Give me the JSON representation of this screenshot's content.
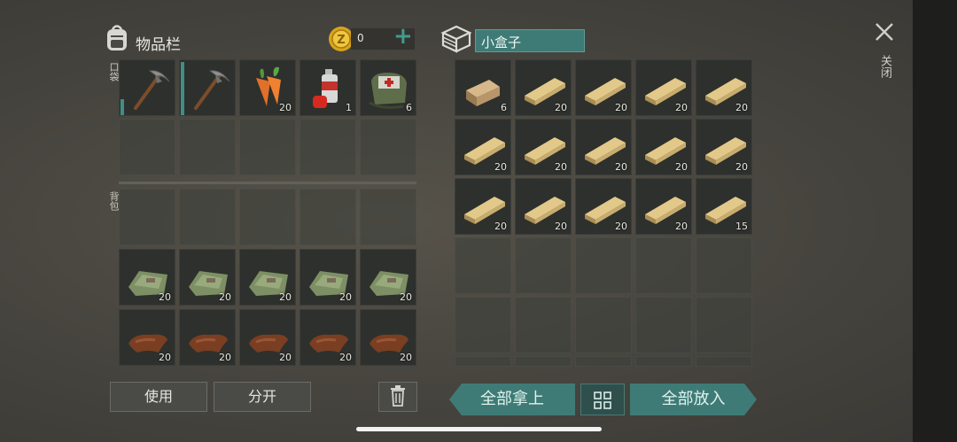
{
  "inventory": {
    "title": "物品栏",
    "coins": "0",
    "plus_label": "+",
    "pocket_label": "口袋",
    "backpack_label": "背包",
    "pocket_row1": [
      {
        "icon": "pickaxe-icon",
        "count": ""
      },
      {
        "icon": "pickaxe-icon",
        "count": ""
      },
      {
        "icon": "carrot-icon",
        "count": "20"
      },
      {
        "icon": "spray-can-icon",
        "count": "1"
      },
      {
        "icon": "first-aid-bag-icon",
        "count": "6"
      }
    ],
    "cloth_counts": [
      "20",
      "20",
      "20",
      "20",
      "20"
    ],
    "leather_counts": [
      "20",
      "20",
      "20",
      "20",
      "20"
    ]
  },
  "container": {
    "name": "小盒子",
    "plank_counts": [
      "6",
      "20",
      "20",
      "20",
      "20",
      "20",
      "20",
      "20",
      "20",
      "20",
      "20",
      "20",
      "20",
      "20",
      "15"
    ]
  },
  "close": {
    "label": "关闭"
  },
  "buttons": {
    "use": "使用",
    "split": "分开",
    "take_all": "全部拿上",
    "put_all": "全部放入"
  },
  "colors": {
    "accent_teal": "#3f7b76",
    "plank": "#e2c98a",
    "slot_bg": "#2e302d"
  }
}
